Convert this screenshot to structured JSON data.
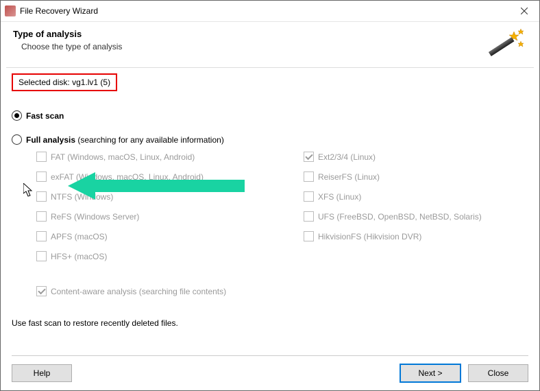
{
  "window": {
    "title": "File Recovery Wizard"
  },
  "header": {
    "title": "Type of analysis",
    "subtitle": "Choose the type of analysis"
  },
  "selected_disk": {
    "label": "Selected disk:",
    "value": "vg1.lv1 (5)"
  },
  "options": {
    "fast": {
      "label": "Fast scan",
      "selected": true
    },
    "full": {
      "label": "Full analysis",
      "paren": "(searching for any available information)",
      "selected": false
    }
  },
  "filesystems_left": [
    {
      "label": "FAT (Windows, macOS, Linux, Android)",
      "checked": false
    },
    {
      "label": "exFAT (Windows, macOS, Linux, Android)",
      "checked": false
    },
    {
      "label": "NTFS (Windows)",
      "checked": false
    },
    {
      "label": "ReFS (Windows Server)",
      "checked": false
    },
    {
      "label": "APFS (macOS)",
      "checked": false
    },
    {
      "label": "HFS+ (macOS)",
      "checked": false
    }
  ],
  "filesystems_right": [
    {
      "label": "Ext2/3/4 (Linux)",
      "checked": true
    },
    {
      "label": "ReiserFS (Linux)",
      "checked": false
    },
    {
      "label": "XFS (Linux)",
      "checked": false
    },
    {
      "label": "UFS (FreeBSD, OpenBSD, NetBSD, Solaris)",
      "checked": false
    },
    {
      "label": "HikvisionFS (Hikvision DVR)",
      "checked": false
    }
  ],
  "content_aware": {
    "label": "Content-aware analysis (searching file contents)",
    "checked": true
  },
  "hint": "Use fast scan to restore recently deleted files.",
  "buttons": {
    "help": "Help",
    "next": "Next >",
    "close": "Close"
  }
}
